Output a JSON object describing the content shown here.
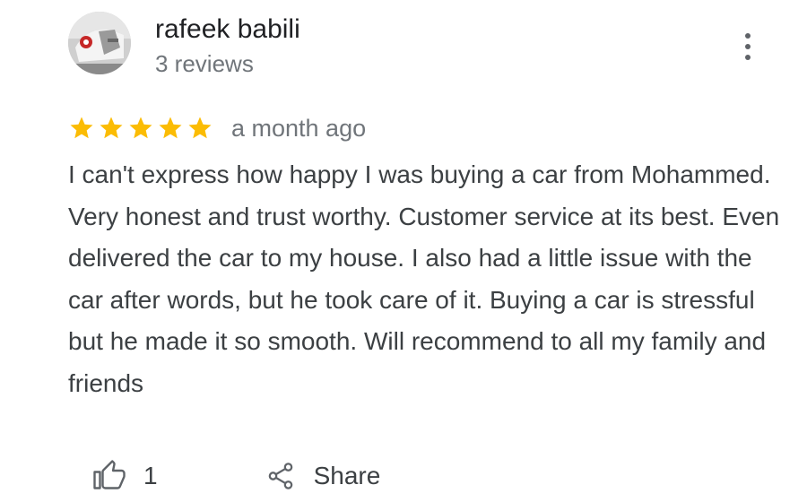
{
  "reviewer": {
    "name": "rafeek babili",
    "review_count": "3 reviews"
  },
  "review": {
    "rating": 5,
    "rating_max": 5,
    "date": "a month ago",
    "text": "I can't express how happy I was buying a car from Mohammed. Very honest and trust worthy. Customer service at its best. Even delivered the car to my house. I also had a little issue with the car after words, but he took care of it. Buying a car is stressful but he made it so smooth. Will recommend to all my family and friends"
  },
  "actions": {
    "like_count": "1",
    "share_label": "Share"
  },
  "colors": {
    "star": "#fbbc04",
    "icon": "#5f6368",
    "name_text": "#202124",
    "secondary_text": "#70757a",
    "body_text": "#3c4043"
  },
  "icons": {
    "more": "more-vert-icon",
    "like": "thumb-up-icon",
    "share": "share-icon",
    "star": "star-icon"
  }
}
